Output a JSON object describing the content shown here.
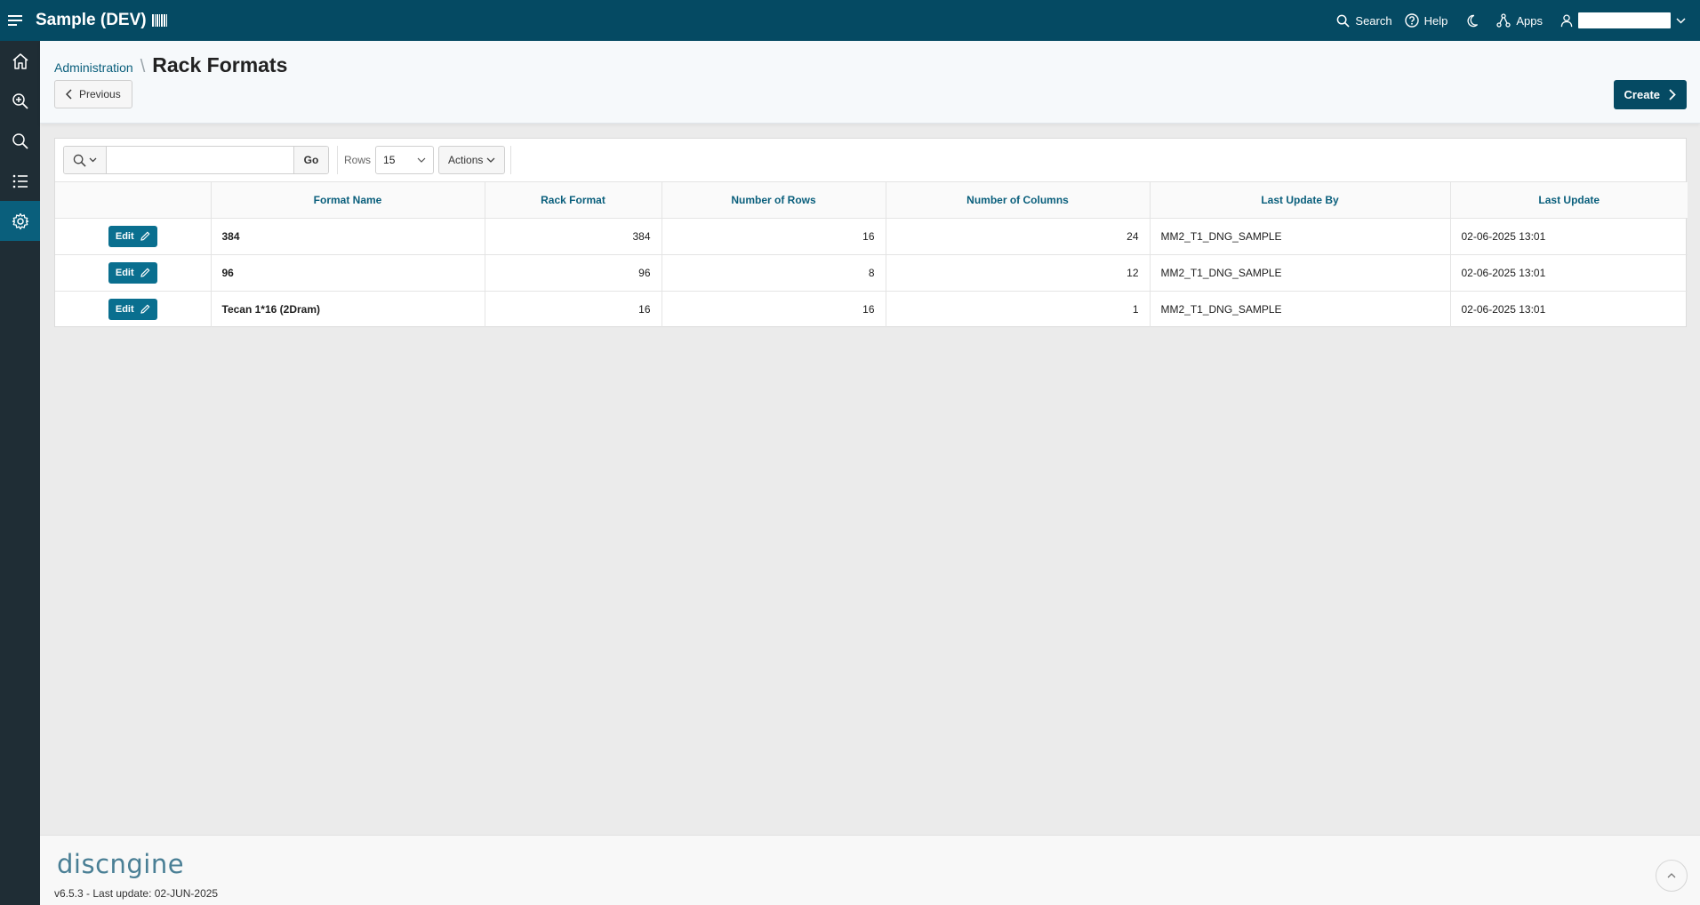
{
  "header": {
    "app_title": "Sample (DEV)",
    "nav": {
      "search": "Search",
      "help": "Help",
      "apps": "Apps"
    }
  },
  "sidebar": {
    "items": [
      {
        "name": "home",
        "icon": "home-icon"
      },
      {
        "name": "zoom",
        "icon": "zoom-in-icon"
      },
      {
        "name": "search",
        "icon": "search-icon"
      },
      {
        "name": "list",
        "icon": "list-icon"
      },
      {
        "name": "settings",
        "icon": "gear-icon",
        "active": true
      }
    ]
  },
  "breadcrumb": {
    "parent": "Administration",
    "separator": "\\",
    "current": "Rack Formats"
  },
  "buttons": {
    "previous": "Previous",
    "create": "Create"
  },
  "toolbar": {
    "go": "Go",
    "rows_label": "Rows",
    "rows_value": "15",
    "actions": "Actions",
    "search_value": ""
  },
  "table": {
    "columns": [
      "Format Name",
      "Rack Format",
      "Number of Rows",
      "Number of Columns",
      "Last Update By",
      "Last Update"
    ],
    "edit_label": "Edit",
    "rows": [
      {
        "format_name": "384",
        "rack_format": "384",
        "num_rows": "16",
        "num_columns": "24",
        "last_update_by": "MM2_T1_DNG_SAMPLE",
        "last_update": "02-06-2025 13:01"
      },
      {
        "format_name": "96",
        "rack_format": "96",
        "num_rows": "8",
        "num_columns": "12",
        "last_update_by": "MM2_T1_DNG_SAMPLE",
        "last_update": "02-06-2025 13:01"
      },
      {
        "format_name": "Tecan 1*16 (2Dram)",
        "rack_format": "16",
        "num_rows": "16",
        "num_columns": "1",
        "last_update_by": "MM2_T1_DNG_SAMPLE",
        "last_update": "02-06-2025 13:01"
      }
    ]
  },
  "footer": {
    "logo_text": "discngine",
    "version": "v6.5.3 - Last update: 02-JUN-2025"
  },
  "colors": {
    "header_bg": "#054a63",
    "sidebar_bg": "#1f2d35",
    "accent": "#0a5f7c",
    "edit_btn": "#0a6f8f"
  }
}
